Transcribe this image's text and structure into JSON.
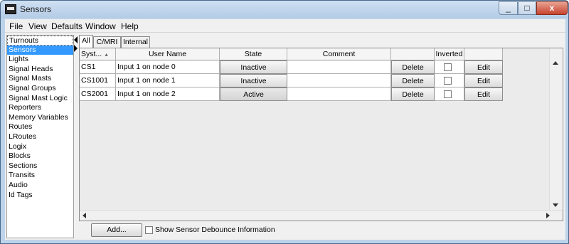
{
  "window": {
    "title": "Sensors"
  },
  "controls": {
    "minimize": "_",
    "maximize": "□",
    "close": "x"
  },
  "menu": [
    "File",
    "View",
    "Defaults",
    "Window",
    "Help"
  ],
  "sidebar": {
    "items": [
      "Turnouts",
      "Sensors",
      "Lights",
      "Signal Heads",
      "Signal Masts",
      "Signal Groups",
      "Signal Mast Logic",
      "Reporters",
      "Memory Variables",
      "Routes",
      "LRoutes",
      "Logix",
      "Blocks",
      "Sections",
      "Transits",
      "Audio",
      "Id Tags"
    ],
    "selected": "Sensors"
  },
  "tabs": [
    "All",
    "C/MRI",
    "Internal"
  ],
  "table": {
    "columns": [
      "Syst...",
      "User Name",
      "State",
      "Comment",
      "",
      "Inverted",
      ""
    ],
    "sort_indicator": "▲",
    "rows": [
      {
        "system": "CS1",
        "user_name": "Input 1 on node 0",
        "state": "Inactive",
        "comment": "",
        "delete": "Delete",
        "inverted": false,
        "edit": "Edit"
      },
      {
        "system": "CS1001",
        "user_name": "Input 1 on node 1",
        "state": "Inactive",
        "comment": "",
        "delete": "Delete",
        "inverted": false,
        "edit": "Edit"
      },
      {
        "system": "CS2001",
        "user_name": "Input 1 on node 2",
        "state": "Active",
        "comment": "",
        "delete": "Delete",
        "inverted": false,
        "edit": "Edit"
      }
    ]
  },
  "footer": {
    "add_label": "Add...",
    "debounce_label": "Show Sensor Debounce Information",
    "debounce_checked": false
  },
  "colors": {
    "selection": "#3399ff",
    "titlebar": "#bcd3ea",
    "close": "#c7432d"
  }
}
